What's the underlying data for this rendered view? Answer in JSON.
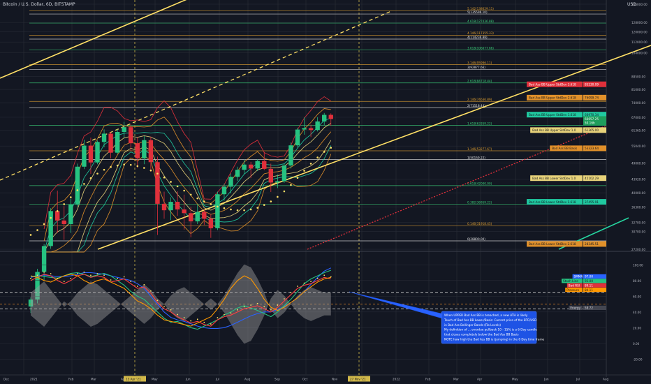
{
  "header": {
    "title": "Bitcoin / U.S. Dollar, 6D, BITSTAMP"
  },
  "currency": "USD",
  "colors": {
    "background": "#131722",
    "grid": "#2a2e39",
    "bull": "#26c281",
    "bear": "#e0303b",
    "trend_yellow": "#ffe066",
    "trend_red": "#e0303b",
    "trend_teal": "#26d6a0",
    "fib_green": "#3bd17a",
    "fib_white": "#e6e6e6",
    "fib_orange": "#e0a030",
    "bb_teal": "#20c9a0",
    "bb_orange": "#e0902a",
    "bb_red": "#e0303b",
    "bb_yellow": "#e8d37a",
    "psar": "#ffe066",
    "stoch_blue": "#2962ff",
    "stoch_green": "#26c281",
    "rsi_red": "#ff4040",
    "pressure_orange": "#ff9800",
    "energy_gray": "#9e9e9e"
  },
  "chart_data": [
    {
      "type": "candlestick",
      "title": "Bitcoin / U.S. Dollar, 6D, BITSTAMP",
      "scale": "log",
      "ylim": [
        27200,
        145000
      ],
      "x_tick_labels": [
        "Dec",
        "2021",
        "Feb",
        "Mar",
        "Apr",
        "13 Apr '21",
        "May",
        "Jun",
        "Jul",
        "Aug",
        "Sep",
        "Oct",
        "Nov",
        "27 Nov '21",
        "2022",
        "Feb",
        "Mar",
        "Apr",
        "May",
        "Jun",
        "Jul",
        "Aug"
      ],
      "y_tick_labels": [
        "145000.00",
        "128000.00",
        "120000.00",
        "112000.00",
        "104000.00",
        "88500.00",
        "81000.00",
        "74000.00",
        "67000.00",
        "61365.00",
        "55040.00",
        "49000.00",
        "43920.00",
        "40000.00",
        "36300.00",
        "32700.00",
        "30700.00",
        "27200.00"
      ],
      "candles": [
        [
          18400,
          19600,
          17600,
          19300
        ],
        [
          19300,
          23800,
          18800,
          23300
        ],
        [
          23300,
          28200,
          21900,
          27800
        ],
        [
          27800,
          36000,
          27300,
          35300
        ],
        [
          35300,
          40600,
          30400,
          33100
        ],
        [
          33100,
          36500,
          29000,
          32300
        ],
        [
          32300,
          38400,
          30400,
          36900
        ],
        [
          36900,
          48800,
          36400,
          47800
        ],
        [
          47800,
          57500,
          47000,
          55200
        ],
        [
          55200,
          58300,
          45500,
          49200
        ],
        [
          49200,
          57200,
          48600,
          56600
        ],
        [
          56600,
          61700,
          54600,
          59900
        ],
        [
          59900,
          60500,
          50600,
          52600
        ],
        [
          52600,
          61700,
          52100,
          60600
        ],
        [
          60600,
          64900,
          58200,
          62600
        ],
        [
          62600,
          63800,
          53200,
          56100
        ],
        [
          56100,
          58400,
          47400,
          50600
        ],
        [
          50600,
          58900,
          48600,
          57300
        ],
        [
          57300,
          58700,
          46200,
          49300
        ],
        [
          49300,
          51200,
          30000,
          37100
        ],
        [
          37100,
          40300,
          33500,
          35500
        ],
        [
          35500,
          38800,
          33200,
          37600
        ],
        [
          37600,
          40400,
          34200,
          35700
        ],
        [
          35700,
          39500,
          31100,
          34800
        ],
        [
          34800,
          36400,
          29500,
          32900
        ],
        [
          32900,
          36900,
          32300,
          35100
        ],
        [
          35100,
          35700,
          32100,
          33500
        ],
        [
          33500,
          34500,
          29400,
          31400
        ],
        [
          31400,
          40300,
          31000,
          39600
        ],
        [
          39600,
          42600,
          37900,
          41700
        ],
        [
          41700,
          45600,
          39800,
          44600
        ],
        [
          44600,
          47800,
          43400,
          46800
        ],
        [
          46800,
          50200,
          45600,
          48500
        ],
        [
          48500,
          49400,
          44200,
          47200
        ],
        [
          47200,
          50300,
          46400,
          49700
        ],
        [
          49700,
          52900,
          46700,
          47100
        ],
        [
          47100,
          48800,
          40200,
          42900
        ],
        [
          42900,
          45300,
          41300,
          43300
        ],
        [
          43300,
          48800,
          42800,
          48200
        ],
        [
          48200,
          56400,
          47200,
          55300
        ],
        [
          55300,
          62400,
          54500,
          61600
        ],
        [
          61600,
          66900,
          59500,
          62200
        ],
        [
          62200,
          63700,
          58500,
          61400
        ],
        [
          61400,
          67000,
          60800,
          65100
        ],
        [
          65100,
          69000,
          63500,
          68100
        ],
        [
          68100,
          68800,
          63200,
          66200
        ]
      ],
      "psar": [
        30000,
        31000,
        32300,
        33700,
        35300,
        37000,
        38800,
        40700,
        42500,
        44200,
        45600,
        46800,
        47700,
        48200,
        48500,
        48400,
        48000,
        47400,
        46600,
        45600,
        44400,
        43100,
        41800,
        40600,
        39500,
        38500,
        37700,
        37000,
        36400,
        36000,
        35700,
        35500,
        35500,
        35700,
        36100,
        36800,
        37700,
        38900,
        40400,
        42200,
        44300,
        46500,
        48800,
        50900,
        52900,
        54400
      ],
      "fib_levels": [
        {
          "label": "5.142(138629.11)",
          "value": 138629.11,
          "color": "#e0a030"
        },
        {
          "label": "5(135596.10)",
          "value": 135596.1,
          "color": "#e6e6e6"
        },
        {
          "label": "4.618(127436.88)",
          "value": 127436.88,
          "color": "#3bd17a"
        },
        {
          "label": "4.146(117355.33)",
          "value": 117355.33,
          "color": "#e0a030"
        },
        {
          "label": "4(114236.88)",
          "value": 114236.88,
          "color": "#e6e6e6"
        },
        {
          "label": "3.618(106077.66)",
          "value": 106077.66,
          "color": "#3bd17a"
        },
        {
          "label": "3.146(95996.11)",
          "value": 95996.11,
          "color": "#e0a030"
        },
        {
          "label": "3(92877.66)",
          "value": 92877.66,
          "color": "#e6e6e6"
        },
        {
          "label": "2.618(84718.44)",
          "value": 84718.44,
          "color": "#3bd17a"
        },
        {
          "label": "2.146(74636.89)",
          "value": 74636.89,
          "color": "#e0a030"
        },
        {
          "label": "2(71518.44)",
          "value": 71518.44,
          "color": "#e6e6e6"
        },
        {
          "label": "1.618(63359.22)",
          "value": 63359.22,
          "color": "#3bd17a"
        },
        {
          "label": "1.146(53277.67)",
          "value": 53277.67,
          "color": "#e0a030"
        },
        {
          "label": "1(50159.22)",
          "value": 50159.22,
          "color": "#e6e6e6"
        },
        {
          "label": "0.618(42000.00)",
          "value": 42000.0,
          "color": "#3bd17a"
        },
        {
          "label": "0.382(36959.22)",
          "value": 36959.22,
          "color": "#3bd17a"
        },
        {
          "label": "0.146(31918.45)",
          "value": 31918.45,
          "color": "#e0a030"
        },
        {
          "label": "0(28800.00)",
          "value": 28800.0,
          "color": "#e6e6e6"
        }
      ],
      "price_tags": [
        {
          "text": "Bad Ass BB Upper StdDev 3.618",
          "value": "85230.09",
          "bg": "#e0303b",
          "fg": "#ffffff",
          "price": 83900
        },
        {
          "text": "Bad Ass BB Upper StdDev 2.618",
          "value": "76099.74",
          "bg": "#e0902a",
          "fg": "#131722",
          "price": 76600
        },
        {
          "text": "Bad Ass BB Upper StdDev 1.618",
          "value": "66970.34",
          "bg": "#20c9a0",
          "fg": "#131722",
          "price": 68200
        },
        {
          "text": "",
          "value": "66657.25",
          "bg": "#1f9e5c",
          "fg": "#ffffff",
          "price": 66200
        },
        {
          "text": "",
          "value": "50.16h",
          "bg": "#1f9e5c",
          "fg": "#ffffff",
          "price": 64500
        },
        {
          "text": "Bad Ass BB Upper StdDev 1.0",
          "value": "61365.00",
          "bg": "#e8d37a",
          "fg": "#131722",
          "price": 61365
        },
        {
          "text": "Bad Ass BB Basis",
          "value": "53323.64",
          "bg": "#e0902a",
          "fg": "#131722",
          "price": 54200
        },
        {
          "text": "Bad Ass BB Lower StdDev 1.0",
          "value": "45102.29",
          "bg": "#e8d37a",
          "fg": "#131722",
          "price": 44200
        },
        {
          "text": "Bad Ass BB Lower StdDev 1.618",
          "value": "37455.91",
          "bg": "#20c9a0",
          "fg": "#131722",
          "price": 37600
        },
        {
          "text": "Bad Ass BB Lower StdDev 2.618",
          "value": "28345.51",
          "bg": "#e0902a",
          "fg": "#131722",
          "price": 28200
        }
      ]
    },
    {
      "type": "line",
      "title": "",
      "ylim": [
        -25,
        110
      ],
      "y_tick_labels": [
        "100.00",
        "80.00",
        "60.00",
        "40.00",
        "20.00",
        "0.00",
        "-20.00"
      ],
      "y_tick_values": [
        100,
        80,
        60,
        40,
        20,
        0,
        -20
      ],
      "reference_lines": [
        65,
        44
      ],
      "series": [
        {
          "name": "Stoch",
          "color": "#2962ff",
          "values": [
            84,
            86,
            87,
            86,
            85,
            85,
            86,
            88,
            90,
            90,
            89,
            88,
            86,
            84,
            82,
            80,
            76,
            70,
            60,
            50,
            40,
            33,
            30,
            28,
            25,
            22,
            20,
            19,
            19,
            20,
            23,
            27,
            31,
            35,
            38,
            40,
            40,
            43,
            47,
            52,
            58,
            66,
            75,
            84,
            92,
            96
          ]
        },
        {
          "name": "Stoch Line",
          "color": "#26c281",
          "values": [
            85,
            86,
            85,
            84,
            83,
            86,
            89,
            90,
            88,
            85,
            87,
            89,
            86,
            80,
            74,
            66,
            60,
            56,
            48,
            40,
            32,
            27,
            28,
            24,
            20,
            18,
            22,
            26,
            30,
            36,
            40,
            45,
            48,
            45,
            42,
            38,
            34,
            40,
            48,
            56,
            66,
            76,
            82,
            86,
            90,
            93
          ]
        },
        {
          "name": "Bad RSI",
          "color": "#ff4040",
          "values": [
            80,
            84,
            88,
            86,
            80,
            76,
            80,
            86,
            88,
            84,
            86,
            84,
            78,
            80,
            82,
            76,
            70,
            72,
            64,
            52,
            44,
            40,
            34,
            30,
            26,
            28,
            24,
            22,
            30,
            34,
            36,
            40,
            44,
            46,
            48,
            44,
            40,
            46,
            54,
            62,
            70,
            74,
            76,
            80,
            84,
            82
          ]
        },
        {
          "name": "Pressure",
          "color": "#ff9800",
          "values": [
            86,
            84,
            80,
            78,
            82,
            86,
            88,
            86,
            80,
            76,
            80,
            82,
            78,
            74,
            70,
            62,
            54,
            50,
            44,
            36,
            30,
            28,
            26,
            24,
            22,
            26,
            30,
            34,
            44,
            56,
            70,
            80,
            86,
            82,
            70,
            56,
            46,
            42,
            46,
            52,
            58,
            66,
            72,
            78,
            82,
            84
          ]
        },
        {
          "name": "Energy",
          "color": "#9e9e9e",
          "values": [
            58,
            62,
            66,
            60,
            54,
            48,
            52,
            58,
            62,
            66,
            64,
            60,
            56,
            52,
            48,
            44,
            40,
            36,
            40,
            46,
            50,
            56,
            60,
            62,
            58,
            54,
            50,
            46,
            50,
            56,
            64,
            72,
            78,
            76,
            68,
            58,
            46,
            40,
            44,
            50,
            56,
            60,
            62,
            60,
            58,
            58
          ]
        }
      ],
      "legend_tags": [
        {
          "text": "SMMA",
          "value": "97.00",
          "bg": "#2962ff",
          "fg": "#ffffff"
        },
        {
          "text": "Stoch Line",
          "value": "92.00",
          "bg": "#26c281",
          "fg": "#131722"
        },
        {
          "text": "Bad RSI",
          "value": "89.11",
          "bg": "#e0303b",
          "fg": "#ffffff"
        },
        {
          "text": "Pressure",
          "value": "84.11",
          "bg": "#ff9800",
          "fg": "#131722"
        },
        {
          "text": "Energy",
          "value": "58.72",
          "bg": "#434651",
          "fg": "#d1d4dc"
        }
      ]
    }
  ],
  "annotation": {
    "lines": [
      "When UPPER Bad Ass BB is breached, a new ATH is likely",
      "Touch of Bad Ass BB Lower/Basis: Current price of the BTC/USD",
      "in Bad Ass Bollinger Bands (Fib Levels)",
      "My definition of ... overdue pullback 10 - 15% is a 6 Day candle",
      "that closes completely below the Bad Ass BB Basis",
      "NOTE how high the Bad Ass BB is (jumping) in the 6 Day time frame"
    ]
  }
}
